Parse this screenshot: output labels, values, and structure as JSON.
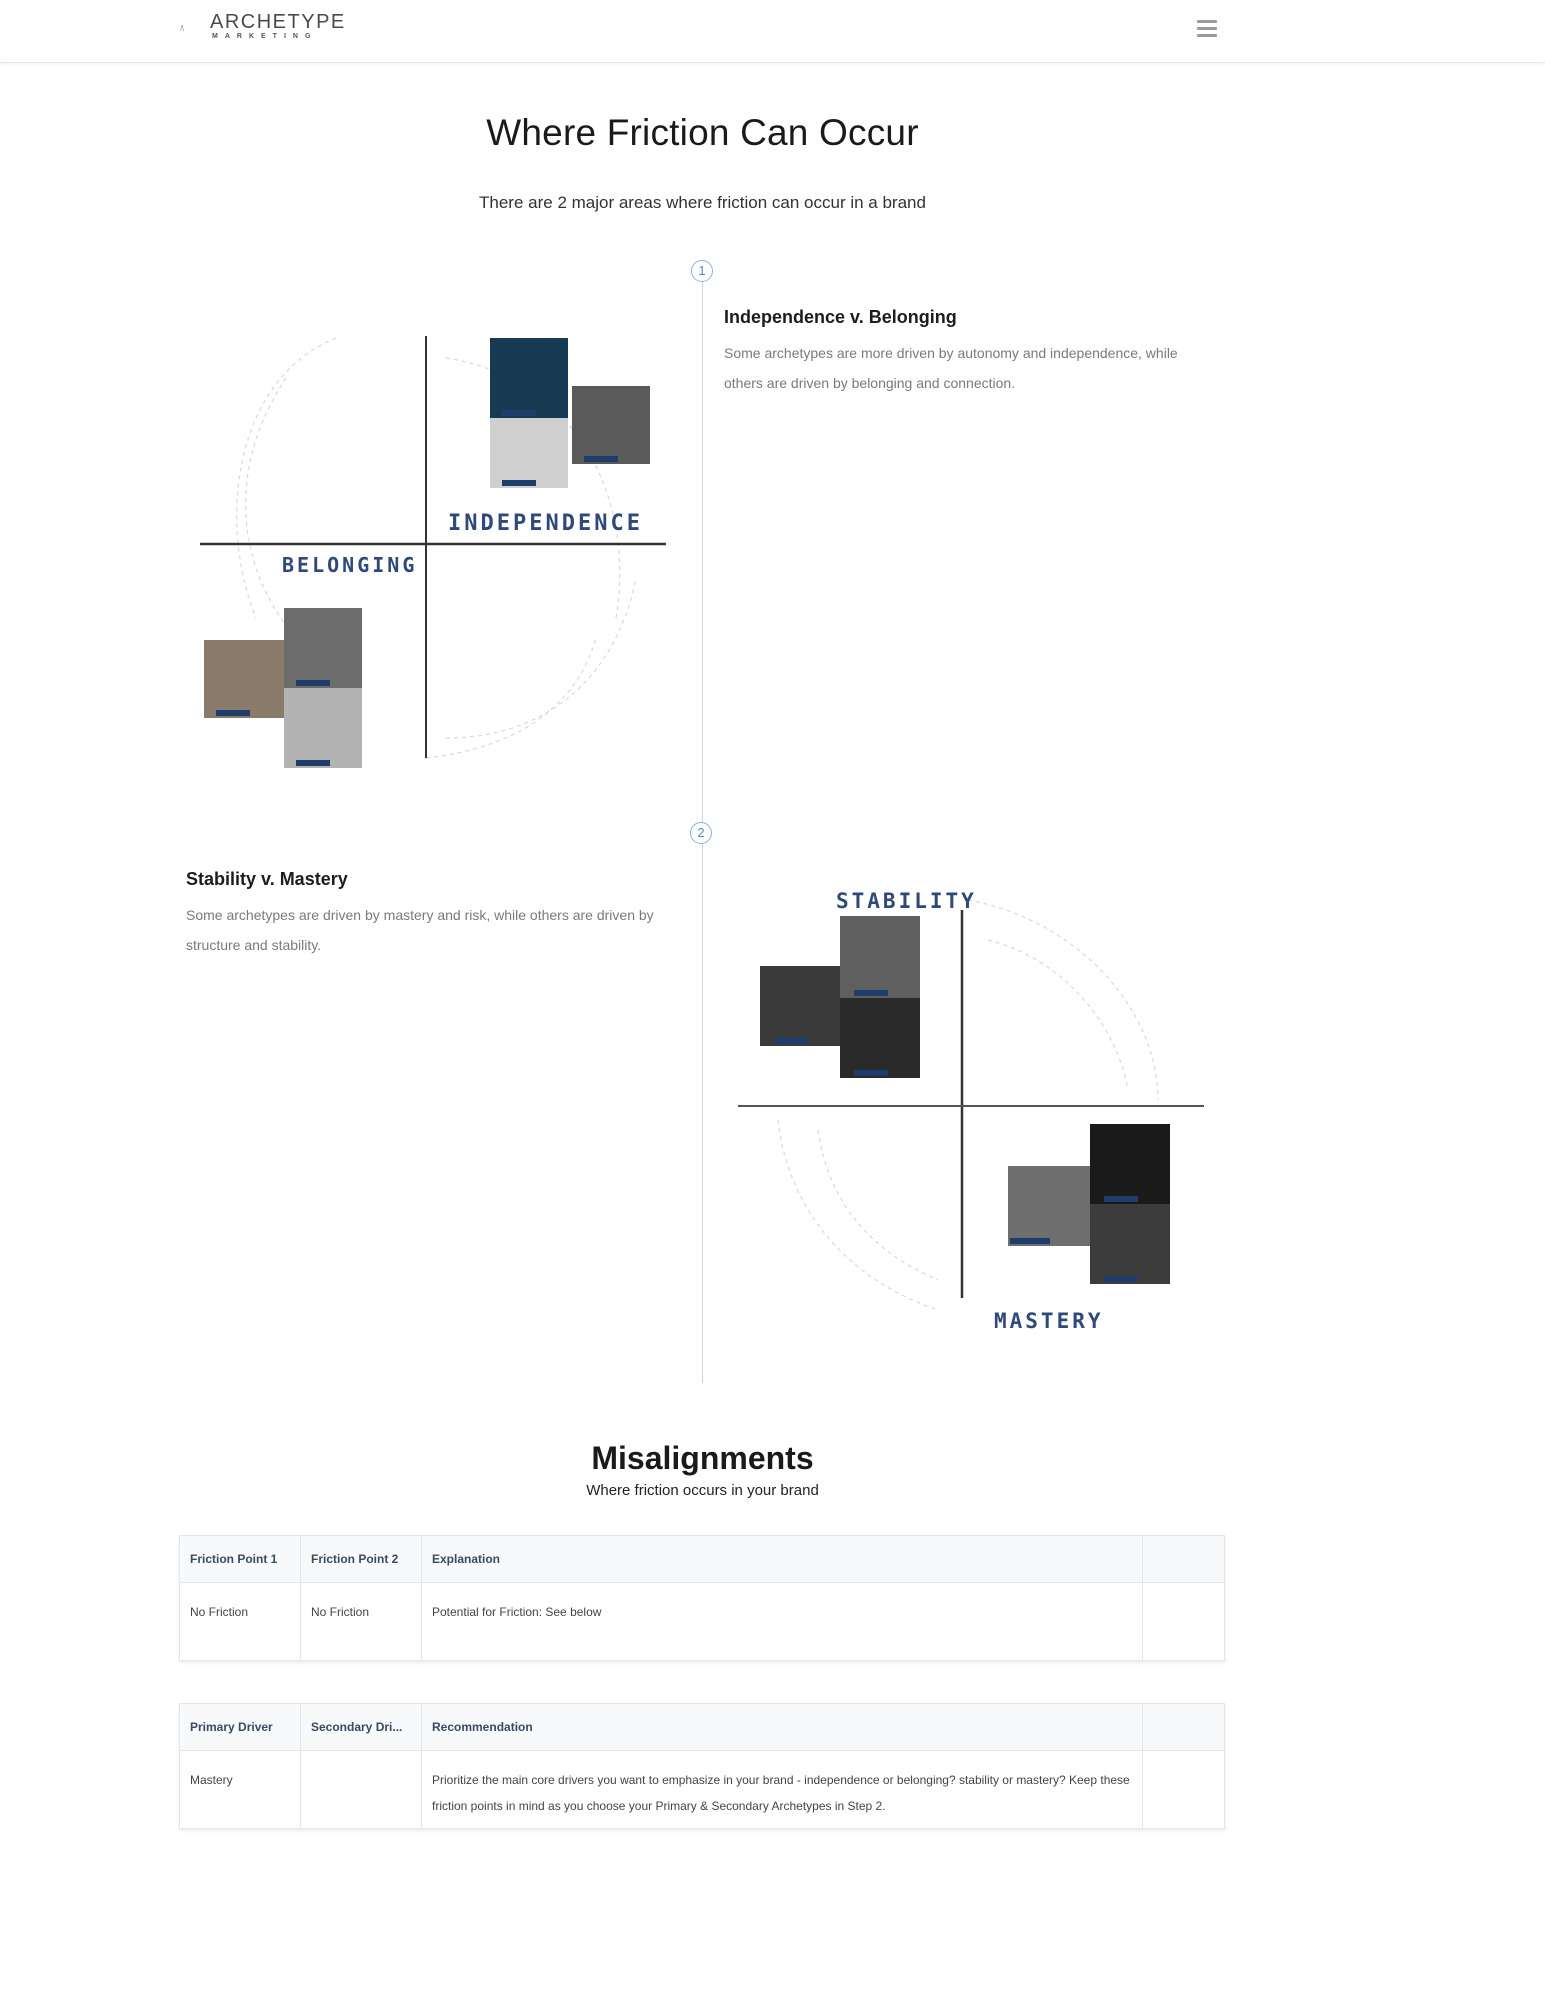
{
  "header": {
    "logo_word": "ARCHETYPE",
    "logo_sub": "MARKETING",
    "menu_icon": "hamburger-menu-icon"
  },
  "page": {
    "title": "Where Friction Can Occur",
    "intro": "There are 2 major areas where friction can occur in a brand"
  },
  "timeline": [
    {
      "step": "1",
      "heading": "Independence v. Belonging",
      "body": "Some archetypes are more driven by autonomy and independence, while others are driven by belonging and connection.",
      "image": {
        "top_label": "INDEPENDENCE",
        "bottom_label": "BELONGING",
        "top_tags": [
          "EXPLORER",
          "INNOCENT",
          "SAGE"
        ],
        "bottom_tags": [
          "JESTER",
          "EVERYMAN",
          "LOVER"
        ]
      }
    },
    {
      "step": "2",
      "heading": "Stability v. Mastery",
      "body": "Some archetypes are driven by mastery and risk, while others are driven by structure and stability.",
      "image": {
        "top_label": "STABILITY",
        "bottom_label": "MASTERY",
        "top_tags": [
          "CAREGIVER",
          "CREATOR",
          "RULER"
        ],
        "bottom_tags": [
          "REBEL",
          "MAGICIAN",
          "HERO"
        ]
      }
    }
  ],
  "misalignments": {
    "title": "Misalignments",
    "subtitle": "Where friction occurs in your brand",
    "table1": {
      "headers": [
        "Friction Point 1",
        "Friction Point 2",
        "Explanation",
        ""
      ],
      "rows": [
        [
          "No Friction",
          "No Friction",
          "Potential for Friction: See below",
          ""
        ]
      ]
    },
    "table2": {
      "headers": [
        "Primary Driver",
        "Secondary Dri...",
        "Recommendation",
        ""
      ],
      "rows": [
        [
          "Mastery",
          "",
          "Prioritize the main core drivers you want to emphasize in your brand - independence or belonging? stability or mastery? Keep these friction points in mind as you choose your Primary & Secondary Archetypes in Step 2.",
          ""
        ]
      ]
    }
  },
  "colors": {
    "accent": "#5b86c9",
    "quad_label": "#2f4a7a",
    "axis": "#333333",
    "tag": "#1f3d6b"
  }
}
